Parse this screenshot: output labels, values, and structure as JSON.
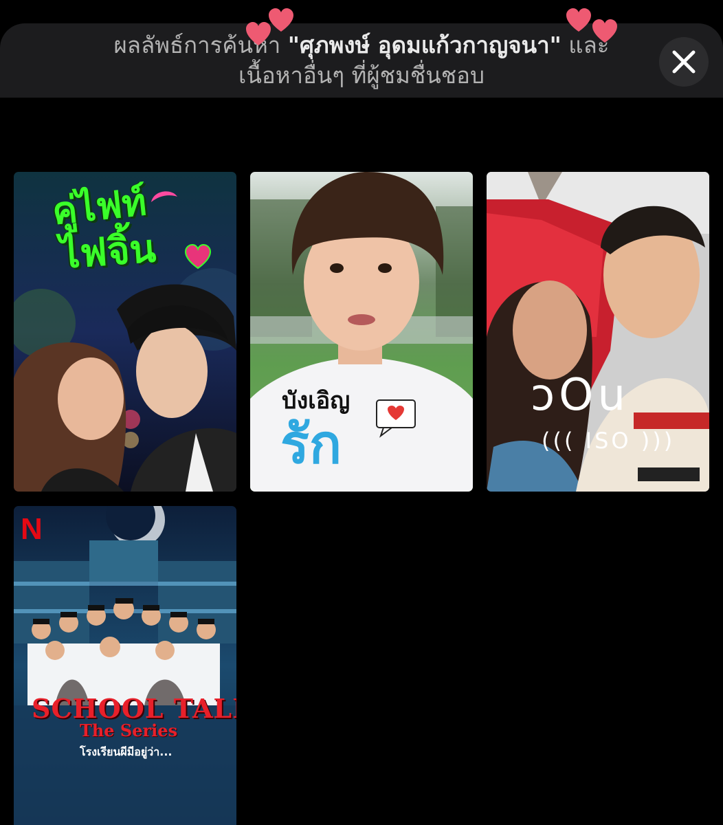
{
  "header": {
    "text_before": "ผลลัพธ์การค้นหา ",
    "query": "\"ศุภพงษ์ อุดมแก้วกาญจนา\"",
    "text_after": " และ",
    "line2": "เนื้อหาอื่นๆ ที่ผู้ชมชื่นชอบ",
    "close_icon": "close-icon",
    "heart_color": "#e94a63"
  },
  "results": [
    {
      "title_line1": "คู่ไฟท์",
      "title_line2": "ไฟจิ้น",
      "accent": "#3aff2a"
    },
    {
      "title_line1": "บังเอิญ",
      "title_line2": "รัก",
      "accent": "#2fa8e0"
    },
    {
      "title_line1": "ɔOu",
      "title_line2": "((( ISO )))",
      "accent": "#ffffff"
    },
    {
      "brand": "N",
      "title_line1": "SCHOOL TALES",
      "title_line2": "The Series",
      "title_line3": "โรงเรียนผีมีอยู่ว่า...",
      "accent": "#e8202a"
    }
  ]
}
